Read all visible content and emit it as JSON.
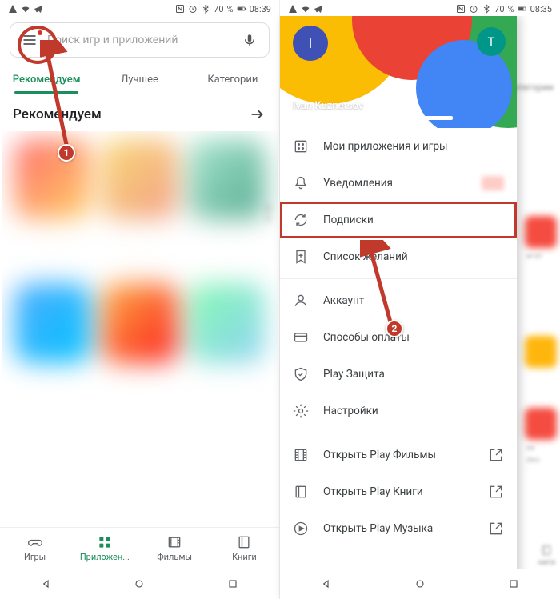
{
  "annotations": {
    "marker1": "1",
    "marker2": "2"
  },
  "left": {
    "status": {
      "time": "08:39",
      "battery": "70"
    },
    "search": {
      "placeholder": "Поиск игр и приложений"
    },
    "tabs": [
      {
        "label": "Рекомендуем",
        "active": true
      },
      {
        "label": "Лучшее",
        "active": false
      },
      {
        "label": "Категории",
        "active": false
      }
    ],
    "section_title": "Рекомендуем",
    "bottom_nav": [
      {
        "label": "Игры",
        "icon": "games-icon"
      },
      {
        "label": "Приложен...",
        "icon": "apps-icon",
        "active": true
      },
      {
        "label": "Фильмы",
        "icon": "movies-icon"
      },
      {
        "label": "Книги",
        "icon": "books-icon"
      }
    ]
  },
  "right": {
    "status": {
      "time": "08:35",
      "battery": "70"
    },
    "bg_tab": "атегории",
    "bg_nav_label": "ниги",
    "bg_text1": "игат",
    "bg_text2": "ее",
    "bg_text3": "deo",
    "user": {
      "initial": "I",
      "initial2": "T",
      "name": "Ivan Kuznetsov"
    },
    "menu": {
      "group1": [
        {
          "label": "Мои приложения и игры",
          "icon": "apps-list-icon"
        },
        {
          "label": "Уведомления",
          "icon": "bell-icon",
          "badge": true
        },
        {
          "label": "Подписки",
          "icon": "refresh-icon",
          "highlight": true
        },
        {
          "label": "Список желаний",
          "icon": "bookmark-plus-icon"
        }
      ],
      "group2": [
        {
          "label": "Аккаунт",
          "icon": "account-icon"
        },
        {
          "label": "Способы оплаты",
          "icon": "card-icon"
        },
        {
          "label": "Play Защита",
          "icon": "shield-icon"
        },
        {
          "label": "Настройки",
          "icon": "gear-icon"
        }
      ],
      "group3": [
        {
          "label": "Открыть Play Фильмы",
          "icon": "film-icon",
          "trail": "open-icon"
        },
        {
          "label": "Открыть Play Книги",
          "icon": "book-open-icon",
          "trail": "open-icon"
        },
        {
          "label": "Открыть Play Музыка",
          "icon": "music-icon",
          "trail": "open-icon"
        }
      ]
    }
  }
}
